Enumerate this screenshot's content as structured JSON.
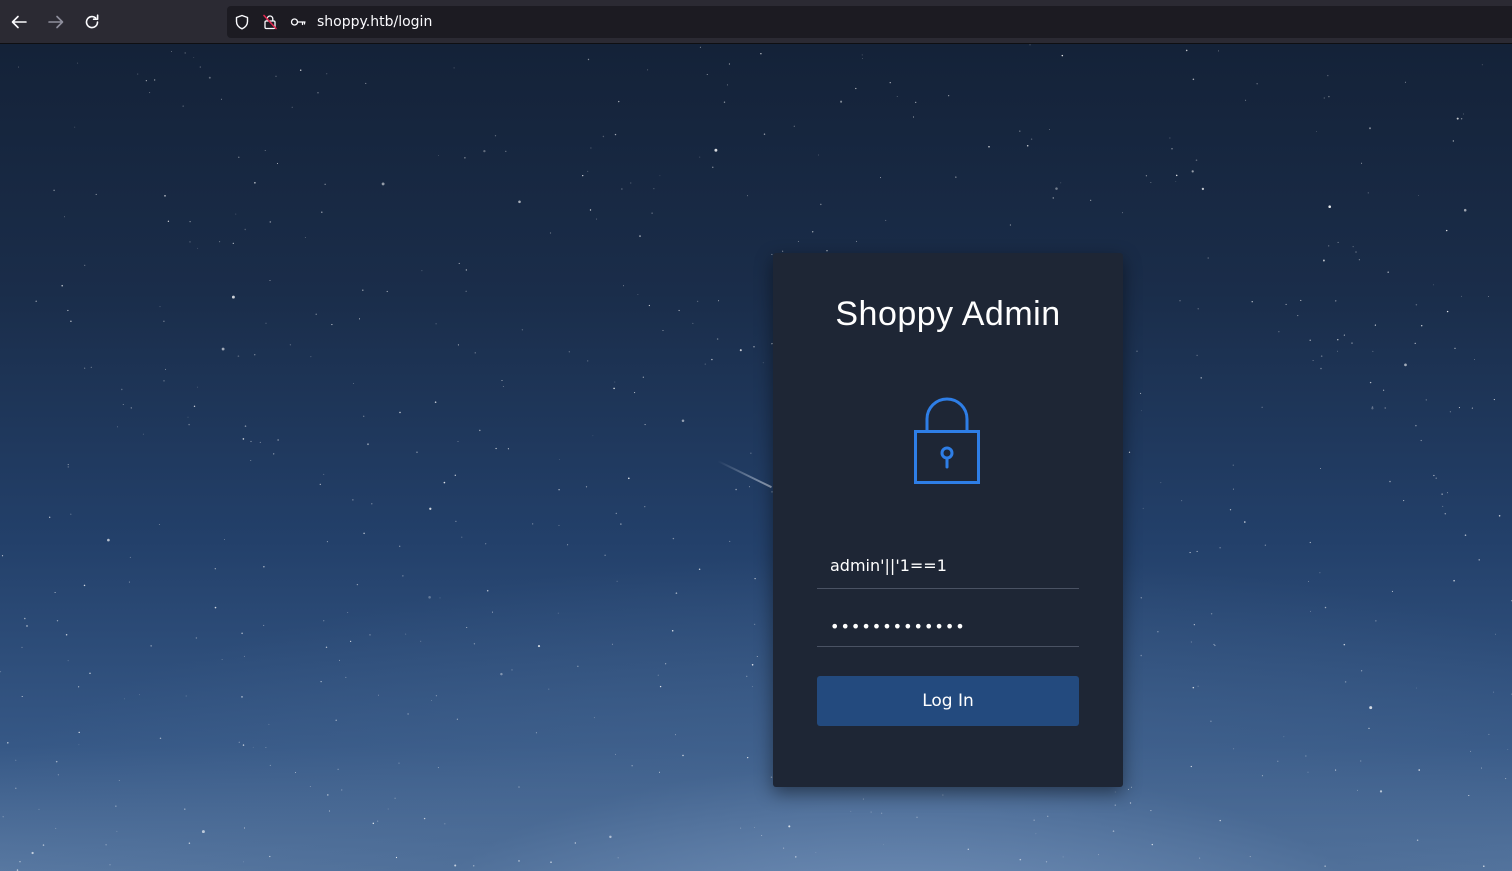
{
  "browser": {
    "url": "shoppy.htb/login",
    "back_icon": "arrow-left-icon",
    "forward_icon": "arrow-right-icon",
    "reload_icon": "reload-icon",
    "shield_icon": "shield-icon",
    "insecure_lock_icon": "insecure-lock-icon",
    "key_icon": "key-icon"
  },
  "login": {
    "title": "Shoppy Admin",
    "icon": "lock-icon",
    "username_value": "admin'||'1==1",
    "password_value": "•••••••••••••",
    "submit_label": "Log In"
  },
  "colors": {
    "accent": "#2e7ee6",
    "button": "#234a7e",
    "card": "#1e2635"
  }
}
